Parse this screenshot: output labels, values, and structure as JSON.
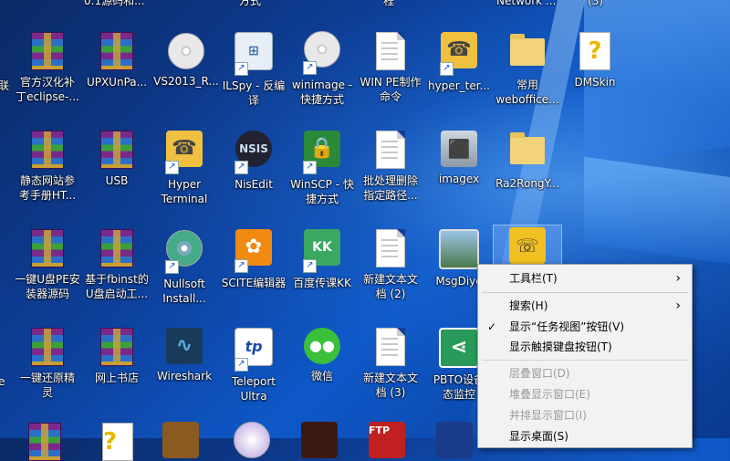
{
  "desktop": {
    "top_labels": [
      "0.1源码和...",
      "方式",
      "程",
      "Network ...",
      "(3)"
    ],
    "row1": [
      {
        "label": "官方汉化补\n丁eclipse-...",
        "icon": "winrar-archive-icon"
      },
      {
        "label": "UPXUnPa...",
        "icon": "winrar-archive-icon"
      },
      {
        "label": "VS2013_R...",
        "icon": "disc-image-icon"
      },
      {
        "label": "ILSpy - 反编\n译",
        "icon": "ilspy-shortcut-icon"
      },
      {
        "label": "winimage -\n快捷方式",
        "icon": "winimage-shortcut-icon"
      },
      {
        "label": "WIN PE制作\n命令",
        "icon": "text-document-icon"
      },
      {
        "label": "hyper_ter...",
        "icon": "hyperterminal-icon"
      },
      {
        "label": "常用\nweboffice...",
        "icon": "folder-icon"
      },
      {
        "label": "DMSkin",
        "icon": "help-book-icon"
      }
    ],
    "row2": [
      {
        "label": "静态网站参\n考手册HT...",
        "icon": "winrar-archive-icon"
      },
      {
        "label": "USB",
        "icon": "winrar-archive-icon"
      },
      {
        "label": "Hyper\nTerminal",
        "icon": "hyperterminal-shortcut-icon"
      },
      {
        "label": "NisEdit",
        "icon": "nsis-shortcut-icon"
      },
      {
        "label": "WinSCP - 快\n捷方式",
        "icon": "winscp-shortcut-icon"
      },
      {
        "label": "批处理删除\n指定路径...",
        "icon": "text-document-icon"
      },
      {
        "label": "imagex",
        "icon": "imagex-icon"
      },
      {
        "label": "Ra2RongY...",
        "icon": "folder-icon"
      }
    ],
    "row3": [
      {
        "label": "一键U盘PE安\n装器源码",
        "icon": "winrar-archive-icon"
      },
      {
        "label": "基于fbinst的\nU盘启动工...",
        "icon": "winrar-archive-icon"
      },
      {
        "label": "Nullsoft\nInstall...",
        "icon": "nsis-installer-icon"
      },
      {
        "label": "SCITE编辑器",
        "icon": "scite-shortcut-icon"
      },
      {
        "label": "百度传课KK",
        "icon": "baidu-kk-icon"
      },
      {
        "label": "新建文本文\n档 (2)",
        "icon": "text-document-icon"
      },
      {
        "label": "MsgDiye",
        "icon": "image-file-icon"
      },
      {
        "label": "",
        "icon": "phone-app-icon"
      }
    ],
    "row4": [
      {
        "label": "一键还原精\n灵",
        "icon": "winrar-archive-icon"
      },
      {
        "label": "网上书店",
        "icon": "winrar-archive-icon"
      },
      {
        "label": "Wireshark",
        "icon": "wireshark-icon"
      },
      {
        "label": "Teleport\nUltra",
        "icon": "teleport-icon"
      },
      {
        "label": "微信",
        "icon": "wechat-icon"
      },
      {
        "label": "新建文本文\n档 (3)",
        "icon": "text-document-icon"
      },
      {
        "label": "PBTO设备\n态监控",
        "icon": "share-app-icon"
      }
    ],
    "left_partial": [
      "联",
      "e"
    ]
  },
  "context_menu": {
    "items": [
      {
        "label": "工具栏(T)",
        "submenu": true,
        "disabled": false
      },
      {
        "label": "搜索(H)",
        "submenu": true,
        "disabled": false
      },
      {
        "label": "显示“任务视图”按钮(V)",
        "checked": true,
        "disabled": false
      },
      {
        "label": "显示触摸键盘按钮(T)",
        "disabled": false
      },
      {
        "label": "层叠窗口(D)",
        "disabled": true
      },
      {
        "label": "堆叠显示窗口(E)",
        "disabled": true
      },
      {
        "label": "并排显示窗口(I)",
        "disabled": true
      },
      {
        "label": "显示桌面(S)",
        "disabled": false
      }
    ],
    "check_glyph": "✓",
    "submenu_glyph": "›"
  },
  "colors": {
    "accent": "#0e58c8",
    "menu_bg": "#f2f2f2",
    "disabled": "#9a9a9a"
  }
}
